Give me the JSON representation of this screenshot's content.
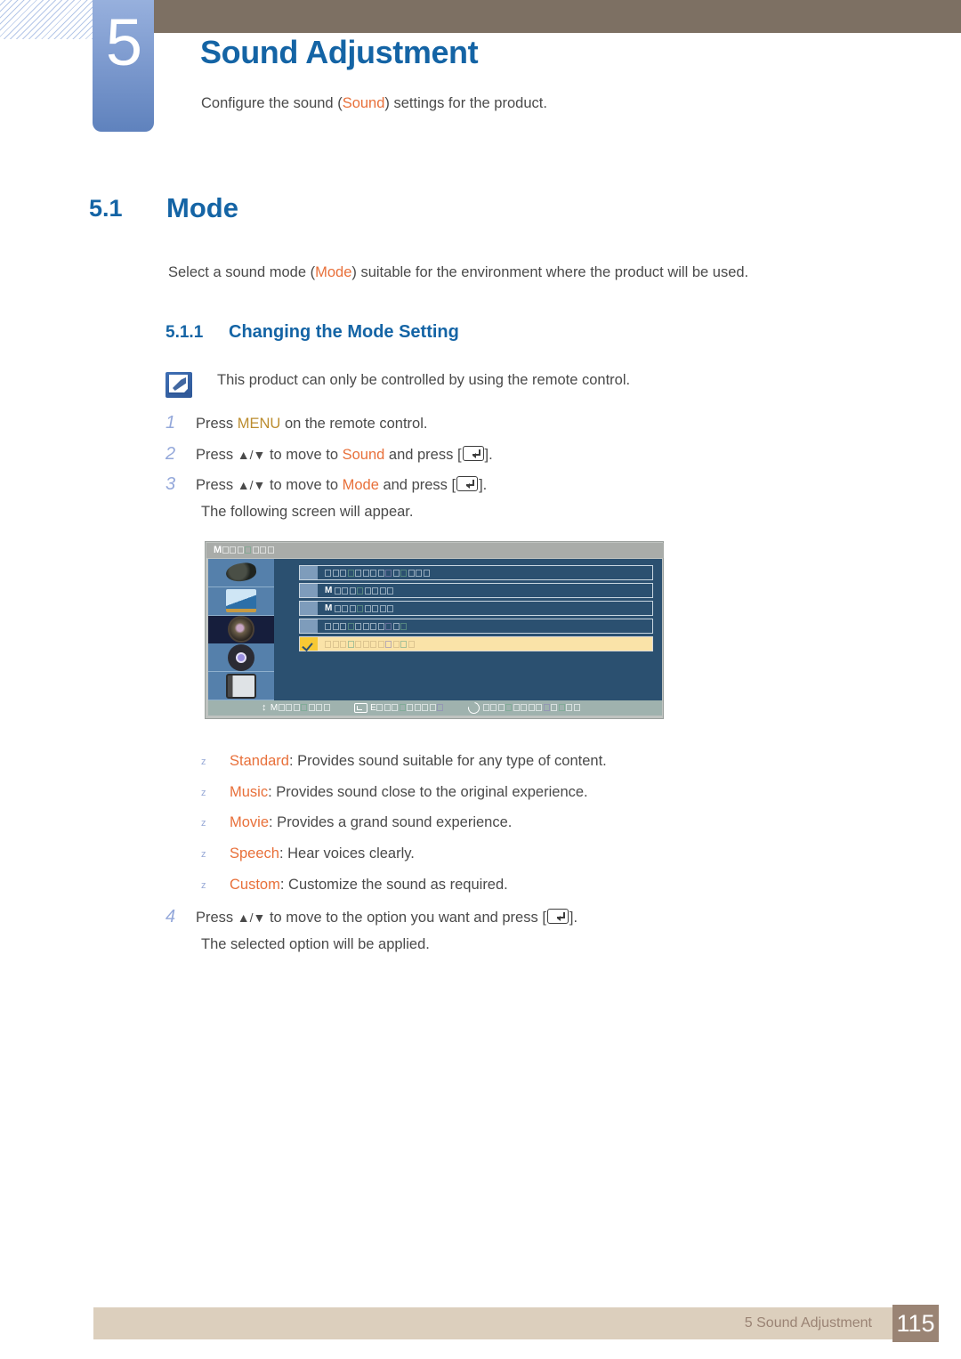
{
  "header": {
    "chapter_number": "5",
    "chapter_title": "Sound Adjustment",
    "description_before": "Configure the sound (",
    "description_keyword": "Sound",
    "description_after": ") settings for the product."
  },
  "section": {
    "number": "5.1",
    "title": "Mode",
    "intro_before": "Select a sound mode (",
    "intro_keyword": "Mode",
    "intro_after": ") suitable for the environment where the product will be used.",
    "sub_number": "5.1.1",
    "sub_title": "Changing the Mode Setting"
  },
  "note": {
    "icon": "note-pencil-icon",
    "text": "This product can only be controlled by using the remote control."
  },
  "steps": [
    {
      "number": "1",
      "prefix": "Press ",
      "keyword": "MENU",
      "keyword_color": "olive",
      "suffix": " on the remote control.",
      "has_enter_key": false
    },
    {
      "number": "2",
      "prefix": "Press ",
      "arrows": "▲/▼",
      "middle": " to move to ",
      "keyword": "Sound",
      "keyword_color": "orange",
      "suffix": " and press [",
      "tail": "].",
      "has_enter_key": true
    },
    {
      "number": "3",
      "prefix": "Press ",
      "arrows": "▲/▼",
      "middle": " to move to ",
      "keyword": "Mode",
      "keyword_color": "orange",
      "suffix": " and press [",
      "tail": "].",
      "has_enter_key": true,
      "followup": "The following screen will appear."
    },
    {
      "number": "4",
      "prefix": "Press ",
      "arrows": "▲/▼",
      "middle": " to move to the option you want and press [",
      "keyword": "",
      "keyword_color": "none",
      "suffix": "",
      "tail": "].",
      "has_enter_key": true,
      "followup": "The selected option will be applied."
    }
  ],
  "osd": {
    "title_text": "M",
    "title_glyphs": 7,
    "sidebar_icons": [
      "picture-icon",
      "screen-adjustment-icon",
      "sound-icon",
      "system-settings-icon",
      "multi-control-icon"
    ],
    "active_sidebar_index": 2,
    "rows": [
      {
        "label_prefix": "",
        "glyphs": 14,
        "selected": false
      },
      {
        "label_prefix": "M",
        "glyphs": 8,
        "selected": false
      },
      {
        "label_prefix": "M",
        "glyphs": 8,
        "selected": false
      },
      {
        "label_prefix": "",
        "glyphs": 11,
        "selected": false
      },
      {
        "label_prefix": "",
        "glyphs": 12,
        "selected": true
      }
    ],
    "footer_hints": [
      {
        "icon": "updown-arrow-icon",
        "prefix": "M",
        "glyphs": 7
      },
      {
        "icon": "enter-key-icon",
        "prefix": "E",
        "glyphs": 9
      },
      {
        "icon": "return-arrow-icon",
        "prefix": "",
        "glyphs": 13
      }
    ]
  },
  "modes": [
    {
      "bullet": "z",
      "name": "Standard",
      "desc": ": Provides sound suitable for any type of content."
    },
    {
      "bullet": "z",
      "name": "Music",
      "desc": ": Provides sound close to the original experience."
    },
    {
      "bullet": "z",
      "name": "Movie",
      "desc": ": Provides a grand sound experience."
    },
    {
      "bullet": "z",
      "name": "Speech",
      "desc": ": Hear voices clearly."
    },
    {
      "bullet": "z",
      "name": "Custom",
      "desc": ": Customize the sound as required."
    }
  ],
  "footer": {
    "text": "5 Sound Adjustment",
    "page": "115"
  },
  "colors": {
    "heading_blue": "#1464a5",
    "keyword_orange": "#e8703a",
    "keyword_olive": "#bb8c2e",
    "header_brown": "#7d7063",
    "footer_tan": "#dccfbd",
    "footer_page_brown": "#9a8474",
    "chapter_tab_blue": "#7e9bcf"
  }
}
